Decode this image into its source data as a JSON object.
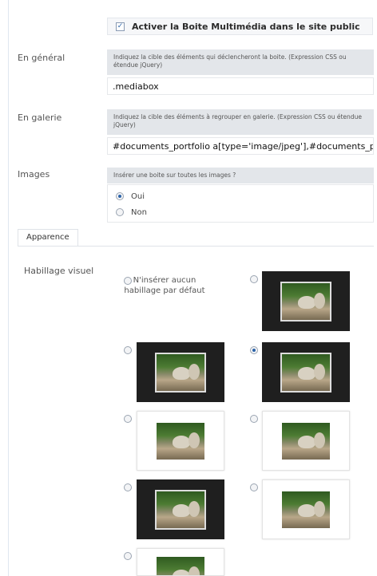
{
  "activate": {
    "checked": true,
    "label": "Activer la Boite Multimédia dans le site public"
  },
  "general": {
    "label": "En général",
    "help": "Indiquez la cible des éléments qui déclencheront la boite. (Expression CSS ou étendue jQuery)",
    "value": ".mediabox"
  },
  "gallery": {
    "label": "En galerie",
    "help": "Indiquez la cible des éléments à regrouper en galerie. (Expression CSS ou étendue jQuery)",
    "value": "#documents_portfolio a[type='image/jpeg'],#documents_port"
  },
  "images": {
    "label": "Images",
    "help": "Insérer une boite sur toutes les images ?",
    "options": [
      {
        "label": "Oui",
        "selected": true
      },
      {
        "label": "Non",
        "selected": false
      }
    ]
  },
  "appearance": {
    "section_title": "Apparence",
    "label": "Habillage visuel",
    "no_theme_label": "N'insérer aucun habillage par défaut",
    "themes": [
      {
        "style": "dark",
        "selected": false
      },
      {
        "style": "dark",
        "selected": false
      },
      {
        "style": "dark",
        "selected": true
      },
      {
        "style": "light",
        "selected": false
      },
      {
        "style": "light",
        "selected": false
      },
      {
        "style": "dark",
        "selected": false
      },
      {
        "style": "light",
        "selected": false
      },
      {
        "style": "light",
        "selected": false
      }
    ]
  },
  "colors": {
    "accent": "#2a62a8",
    "help_bg": "#e3e6ea"
  }
}
